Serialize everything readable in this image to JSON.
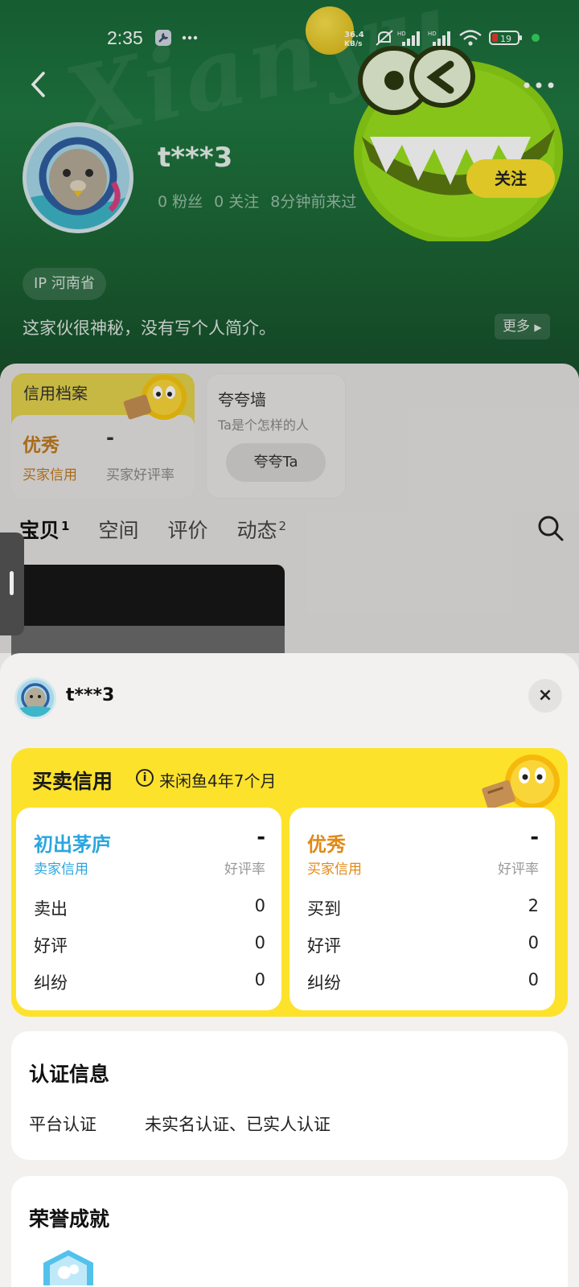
{
  "status_bar": {
    "time": "2:35",
    "net_speed": "36.4 KB/s",
    "battery": "19"
  },
  "profile": {
    "username": "t***3",
    "fans": "0 粉丝",
    "following": "0 关注",
    "last_seen": "8分钟前来过",
    "follow_label": "关注",
    "ip_location": "IP 河南省",
    "bio": "这家伙很神秘，没有写个人简介。",
    "more_label": "更多"
  },
  "credit_card": {
    "title": "信用档案",
    "grade": "优秀",
    "grade_label": "买家信用",
    "rate": "-",
    "rate_label": "买家好评率"
  },
  "praise_card": {
    "title": "夸夸墙",
    "subtitle": "Ta是个怎样的人",
    "button": "夸夸Ta"
  },
  "tabs": [
    {
      "label": "宝贝",
      "count": "1"
    },
    {
      "label": "空间",
      "count": ""
    },
    {
      "label": "评价",
      "count": ""
    },
    {
      "label": "动态",
      "count": "2"
    }
  ],
  "sheet": {
    "username": "t***3",
    "close_icon": "×",
    "credit_title": "买卖信用",
    "since": "来闲鱼4年7个月",
    "seller": {
      "grade": "初出茅庐",
      "grade_label": "卖家信用",
      "rate": "-",
      "rate_label": "好评率",
      "rows": [
        {
          "label": "卖出",
          "value": "0"
        },
        {
          "label": "好评",
          "value": "0"
        },
        {
          "label": "纠纷",
          "value": "0"
        }
      ]
    },
    "buyer": {
      "grade": "优秀",
      "grade_label": "买家信用",
      "rate": "-",
      "rate_label": "好评率",
      "rows": [
        {
          "label": "买到",
          "value": "2"
        },
        {
          "label": "好评",
          "value": "0"
        },
        {
          "label": "纠纷",
          "value": "0"
        }
      ]
    },
    "cert": {
      "title": "认证信息",
      "label": "平台认证",
      "value": "未实名认证、已实人认证"
    },
    "honor": {
      "title": "荣誉成就"
    }
  },
  "colors": {
    "header_green": "#1f7840",
    "accent_yellow": "#fde22c",
    "seller_blue": "#2aa6e0",
    "buyer_orange": "#e08a16"
  }
}
